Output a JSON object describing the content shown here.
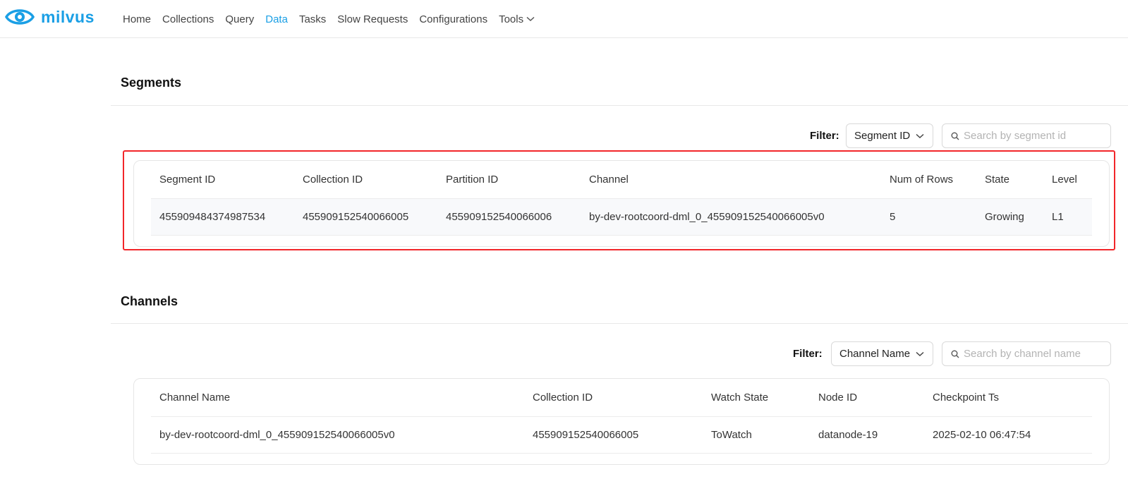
{
  "app": {
    "logo_text": "milvus",
    "brand_color": "#1a9fe5"
  },
  "nav": {
    "items": [
      {
        "label": "Home"
      },
      {
        "label": "Collections"
      },
      {
        "label": "Query"
      },
      {
        "label": "Data",
        "active": true
      },
      {
        "label": "Tasks"
      },
      {
        "label": "Slow Requests"
      },
      {
        "label": "Configurations"
      },
      {
        "label": "Tools"
      }
    ]
  },
  "segments": {
    "title": "Segments",
    "filter_label": "Filter:",
    "filter_select": "Segment ID",
    "search_placeholder": "Search by segment id",
    "columns": [
      "Segment ID",
      "Collection ID",
      "Partition ID",
      "Channel",
      "Num of Rows",
      "State",
      "Level"
    ],
    "rows": [
      [
        "455909484374987534",
        "455909152540066005",
        "455909152540066006",
        "by-dev-rootcoord-dml_0_455909152540066005v0",
        "5",
        "Growing",
        "L1"
      ]
    ],
    "highlight_color": "#f2262a"
  },
  "channels": {
    "title": "Channels",
    "filter_label": "Filter:",
    "filter_select": "Channel Name",
    "search_placeholder": "Search by channel name",
    "columns": [
      "Channel Name",
      "Collection ID",
      "Watch State",
      "Node ID",
      "Checkpoint Ts"
    ],
    "rows": [
      [
        "by-dev-rootcoord-dml_0_455909152540066005v0",
        "455909152540066005",
        "ToWatch",
        "datanode-19",
        "2025-02-10 06:47:54"
      ]
    ]
  },
  "icons": {
    "logo": "milvus-eye-icon",
    "dropdown": "chevron-down-icon",
    "search": "search-icon"
  }
}
